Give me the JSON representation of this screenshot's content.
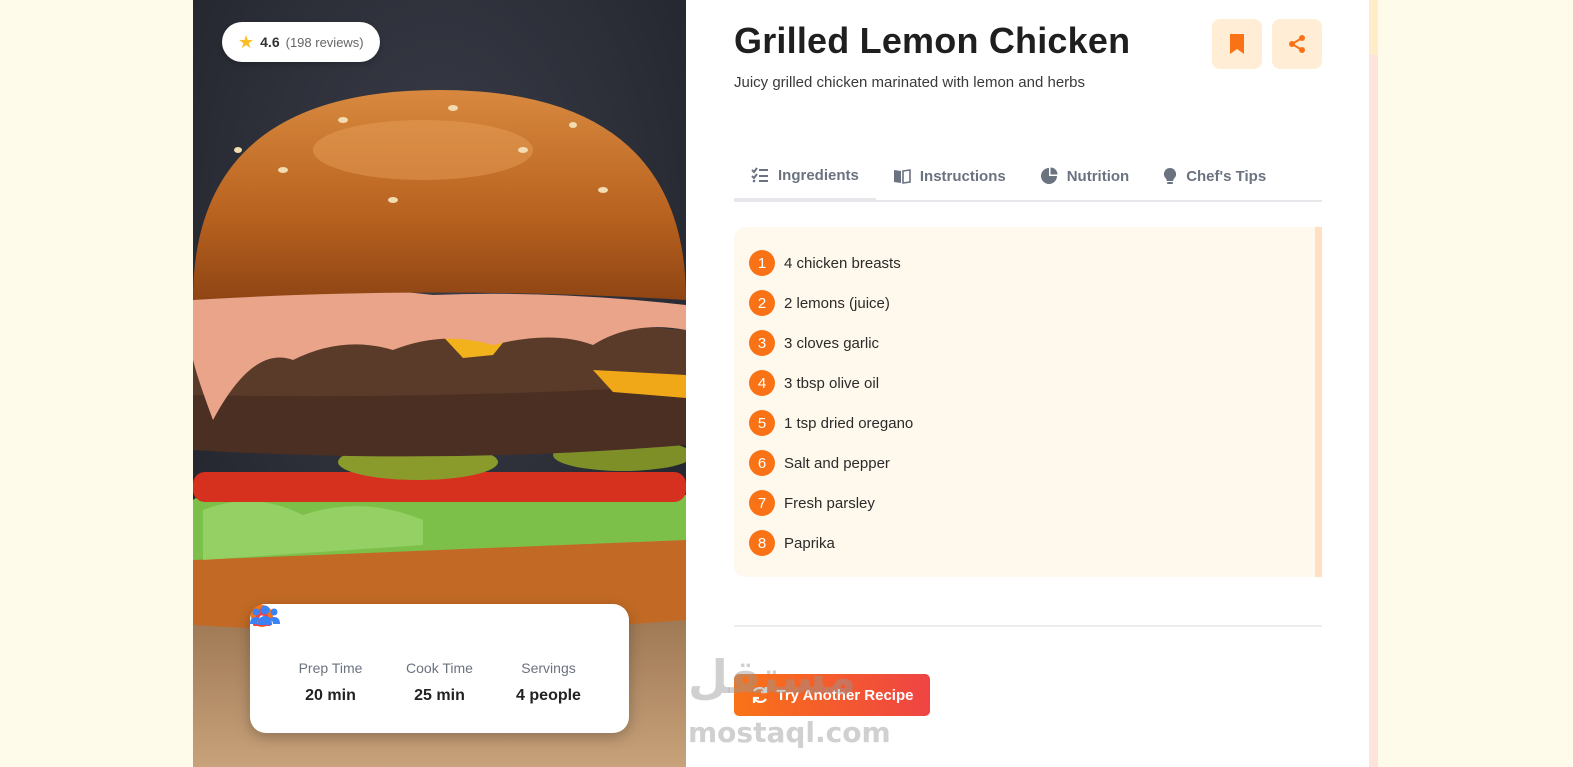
{
  "recipe": {
    "title": "Grilled Lemon Chicken",
    "subtitle": "Juicy grilled chicken marinated with lemon and herbs",
    "rating": "4.6",
    "reviews": "(198 reviews)"
  },
  "stats": [
    {
      "label": "Prep Time",
      "value": "20 min",
      "icon": "clock-icon"
    },
    {
      "label": "Cook Time",
      "value": "25 min",
      "icon": "fire-icon"
    },
    {
      "label": "Servings",
      "value": "4 people",
      "icon": "users-icon"
    }
  ],
  "actions": {
    "bookmark_icon": "bookmark-icon",
    "share_icon": "share-icon"
  },
  "tabs": [
    {
      "label": "Ingredients",
      "icon": "list-check-icon"
    },
    {
      "label": "Instructions",
      "icon": "book-open-icon"
    },
    {
      "label": "Nutrition",
      "icon": "pie-chart-icon"
    },
    {
      "label": "Chef's Tips",
      "icon": "lightbulb-icon"
    }
  ],
  "ingredients": [
    {
      "num": "1",
      "text": "4 chicken breasts"
    },
    {
      "num": "2",
      "text": "2 lemons (juice)"
    },
    {
      "num": "3",
      "text": "3 cloves garlic"
    },
    {
      "num": "4",
      "text": "3 tbsp olive oil"
    },
    {
      "num": "5",
      "text": "1 tsp dried oregano"
    },
    {
      "num": "6",
      "text": "Salt and pepper"
    },
    {
      "num": "7",
      "text": "Fresh parsley"
    },
    {
      "num": "8",
      "text": "Paprika"
    }
  ],
  "cta": {
    "label": "Try Another Recipe",
    "icon": "refresh-icon"
  },
  "watermark": {
    "arabic": "مستقل",
    "latin": "mostaql.com"
  },
  "colors": {
    "accent": "#f97316",
    "accent_end": "#ef4444",
    "soft_bg": "#fff8ec",
    "page_bg": "#fffbea"
  }
}
